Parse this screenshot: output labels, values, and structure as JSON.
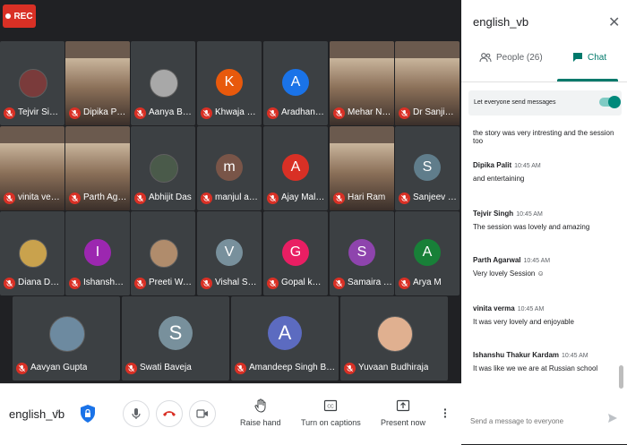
{
  "recording": {
    "label": "REC"
  },
  "participants": [
    {
      "name": "Tejvir Singh",
      "avatar": "img",
      "color": "#7a3b3b"
    },
    {
      "name": "Dipika Palit",
      "avatar": "photo"
    },
    {
      "name": "Aanya Baveja",
      "avatar": "img",
      "color": "#a8a8a8"
    },
    {
      "name": "Khwaja Moh...",
      "avatar": "letter",
      "letter": "K",
      "color": "#e8590c"
    },
    {
      "name": "Aradhana Ya...",
      "avatar": "letter",
      "letter": "A",
      "color": "#1a73e8"
    },
    {
      "name": "Mehar Nagi",
      "avatar": "photo"
    },
    {
      "name": "Dr Sanjib Ku...",
      "avatar": "photo"
    },
    {
      "name": "vinita verma",
      "avatar": "photo"
    },
    {
      "name": "Parth Agarwal",
      "avatar": "photo"
    },
    {
      "name": "Abhijit Das",
      "avatar": "img",
      "color": "#4a5a4a"
    },
    {
      "name": "manjul arora",
      "avatar": "letter",
      "letter": "m",
      "color": "#795548"
    },
    {
      "name": "Ajay Malhotra",
      "avatar": "letter",
      "letter": "A",
      "color": "#d93025"
    },
    {
      "name": "Hari Ram",
      "avatar": "photo"
    },
    {
      "name": "Sanjeev kumar",
      "avatar": "letter",
      "letter": "S",
      "color": "#607d8b"
    },
    {
      "name": "Diana Democ...",
      "avatar": "img",
      "color": "#c9a24d"
    },
    {
      "name": "Ishanshu Tha...",
      "avatar": "letter",
      "letter": "I",
      "color": "#9c27b0"
    },
    {
      "name": "Preeti Wadera",
      "avatar": "img",
      "color": "#b08c6c"
    },
    {
      "name": "Vishal Sharma",
      "avatar": "letter",
      "letter": "V",
      "color": "#78909c"
    },
    {
      "name": "Gopal kumar",
      "avatar": "letter",
      "letter": "G",
      "color": "#e91e63"
    },
    {
      "name": "Samaira Tan...",
      "avatar": "letter",
      "letter": "S",
      "color": "#8e44ad"
    },
    {
      "name": "Arya M",
      "avatar": "letter",
      "letter": "A",
      "color": "#188038"
    },
    {
      "name": "Aavyan Gupta",
      "avatar": "img",
      "color": "#6d8aa0"
    },
    {
      "name": "Swati Baveja",
      "avatar": "letter",
      "letter": "S",
      "color": "#78909c"
    },
    {
      "name": "Amandeep Singh Bajaj",
      "avatar": "letter",
      "letter": "A",
      "color": "#5c6bc0"
    },
    {
      "name": "Yuvaan Budhiraja",
      "avatar": "img",
      "color": "#e0b090"
    }
  ],
  "bottombar": {
    "meeting_code": "english_vb",
    "raise_hand": "Raise hand",
    "captions": "Turn on captions",
    "present": "Present now"
  },
  "panel": {
    "title": "english_vb",
    "people_tab": "People (26)",
    "chat_tab": "Chat",
    "let_everyone": "Let everyone send messages",
    "first_line": "the story was very  intresting and the session too",
    "messages": [
      {
        "sender": "Dipika Palit",
        "time": "10:45 AM",
        "text": "and entertaining"
      },
      {
        "sender": "Tejvir Singh",
        "time": "10:45 AM",
        "text": "The session was lovely and amazing"
      },
      {
        "sender": "Parth Agarwal",
        "time": "10:45 AM",
        "text": "Very lovely Session ☺"
      },
      {
        "sender": "vinita verma",
        "time": "10:45 AM",
        "text": "It was very lovely and enjoyable"
      },
      {
        "sender": "Ishanshu Thakur Kardam",
        "time": "10:45 AM",
        "text": "It was like we we are at Russian school"
      }
    ],
    "compose_placeholder": "Send a message to everyone"
  }
}
